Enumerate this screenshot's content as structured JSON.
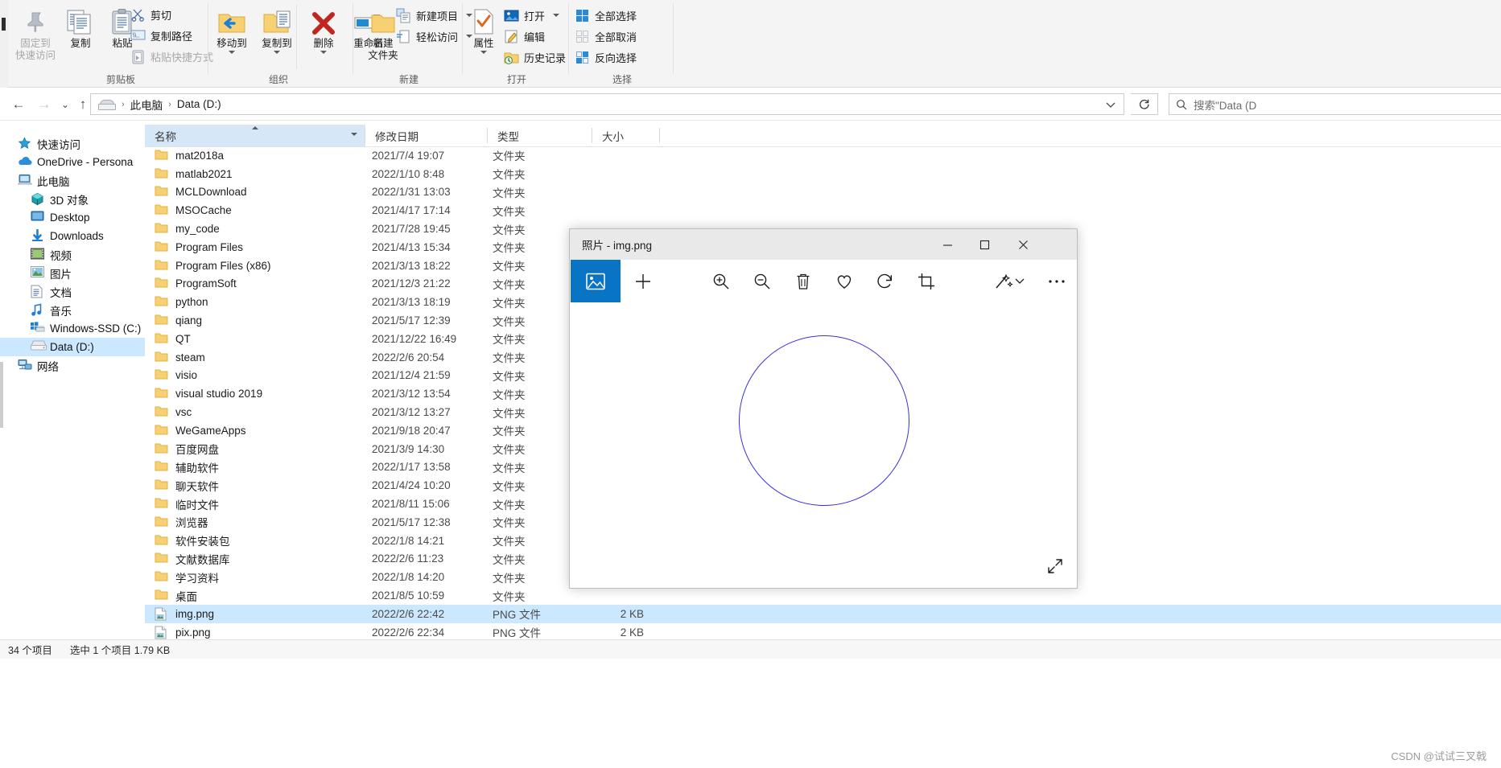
{
  "ribbon": {
    "groups": [
      {
        "id": "clipboard",
        "label": "剪贴板"
      },
      {
        "id": "organize",
        "label": "组织"
      },
      {
        "id": "new",
        "label": "新建"
      },
      {
        "id": "open",
        "label": "打开"
      },
      {
        "id": "select",
        "label": "选择"
      }
    ],
    "pin_to_quick_access": {
      "line1": "固定到",
      "line2": "快速访问"
    },
    "copy": "复制",
    "paste": "粘贴",
    "cut": "剪切",
    "copy_path": "复制路径",
    "paste_shortcut": "粘贴快捷方式",
    "move_to": "移动到",
    "copy_to": "复制到",
    "delete": "删除",
    "rename": "重命名",
    "new_folder": {
      "line1": "新建",
      "line2": "文件夹"
    },
    "new_item": "新建项目",
    "easy_access": "轻松访问",
    "properties": "属性",
    "open": "打开",
    "edit": "编辑",
    "history": "历史记录",
    "select_all": "全部选择",
    "select_none": "全部取消",
    "invert_selection": "反向选择"
  },
  "address": {
    "breadcrumbs": [
      "此电脑",
      "Data (D:)"
    ],
    "separator": "›",
    "back_icon": "←",
    "forward_icon": "→",
    "recent_icon": "⌄",
    "up_icon": "↑",
    "refresh_icon": "↻",
    "drive_icon": "drive-icon"
  },
  "search": {
    "placeholder": "搜索\"Data (D",
    "icon": "search-icon"
  },
  "sidebar": {
    "items": [
      {
        "label": "快速访问",
        "icon": "star-pin-icon",
        "level": 1,
        "selected": false
      },
      {
        "label": "OneDrive - Persona",
        "icon": "onedrive-cloud-icon",
        "level": 1,
        "selected": false
      },
      {
        "label": "此电脑",
        "icon": "this-pc-icon",
        "level": 1,
        "selected": false
      },
      {
        "label": "3D 对象",
        "icon": "3d-objects-icon",
        "level": 2,
        "selected": false
      },
      {
        "label": "Desktop",
        "icon": "desktop-icon",
        "level": 2,
        "selected": false
      },
      {
        "label": "Downloads",
        "icon": "downloads-icon",
        "level": 2,
        "selected": false
      },
      {
        "label": "视频",
        "icon": "videos-icon",
        "level": 2,
        "selected": false
      },
      {
        "label": "图片",
        "icon": "pictures-icon",
        "level": 2,
        "selected": false
      },
      {
        "label": "文档",
        "icon": "documents-icon",
        "level": 2,
        "selected": false
      },
      {
        "label": "音乐",
        "icon": "music-icon",
        "level": 2,
        "selected": false
      },
      {
        "label": "Windows-SSD (C:)",
        "icon": "drive-windows-icon",
        "level": 2,
        "selected": false
      },
      {
        "label": "Data (D:)",
        "icon": "drive-icon",
        "level": 2,
        "selected": true
      },
      {
        "label": "网络",
        "icon": "network-icon",
        "level": 1,
        "selected": false
      }
    ]
  },
  "filelist": {
    "columns": [
      {
        "key": "name",
        "label": "名称",
        "sorted": true
      },
      {
        "key": "date",
        "label": "修改日期",
        "sorted": false
      },
      {
        "key": "type",
        "label": "类型",
        "sorted": false
      },
      {
        "key": "size",
        "label": "大小",
        "sorted": false
      }
    ],
    "rows": [
      {
        "name": "mat2018a",
        "date": "2021/7/4 19:07",
        "type": "文件夹",
        "size": "",
        "icon": "folder-icon",
        "selected": false
      },
      {
        "name": "matlab2021",
        "date": "2022/1/10 8:48",
        "type": "文件夹",
        "size": "",
        "icon": "folder-icon",
        "selected": false
      },
      {
        "name": "MCLDownload",
        "date": "2022/1/31 13:03",
        "type": "文件夹",
        "size": "",
        "icon": "folder-icon",
        "selected": false
      },
      {
        "name": "MSOCache",
        "date": "2021/4/17 17:14",
        "type": "文件夹",
        "size": "",
        "icon": "folder-icon",
        "selected": false
      },
      {
        "name": "my_code",
        "date": "2021/7/28 19:45",
        "type": "文件夹",
        "size": "",
        "icon": "folder-icon",
        "selected": false
      },
      {
        "name": "Program Files",
        "date": "2021/4/13 15:34",
        "type": "文件夹",
        "size": "",
        "icon": "folder-icon",
        "selected": false
      },
      {
        "name": "Program Files (x86)",
        "date": "2021/3/13 18:22",
        "type": "文件夹",
        "size": "",
        "icon": "folder-icon",
        "selected": false
      },
      {
        "name": "ProgramSoft",
        "date": "2021/12/3 21:22",
        "type": "文件夹",
        "size": "",
        "icon": "folder-icon",
        "selected": false
      },
      {
        "name": "python",
        "date": "2021/3/13 18:19",
        "type": "文件夹",
        "size": "",
        "icon": "folder-icon",
        "selected": false
      },
      {
        "name": "qiang",
        "date": "2021/5/17 12:39",
        "type": "文件夹",
        "size": "",
        "icon": "folder-icon",
        "selected": false
      },
      {
        "name": "QT",
        "date": "2021/12/22 16:49",
        "type": "文件夹",
        "size": "",
        "icon": "folder-icon",
        "selected": false
      },
      {
        "name": "steam",
        "date": "2022/2/6 20:54",
        "type": "文件夹",
        "size": "",
        "icon": "folder-icon",
        "selected": false
      },
      {
        "name": "visio",
        "date": "2021/12/4 21:59",
        "type": "文件夹",
        "size": "",
        "icon": "folder-icon",
        "selected": false
      },
      {
        "name": "visual studio 2019",
        "date": "2021/3/12 13:54",
        "type": "文件夹",
        "size": "",
        "icon": "folder-icon",
        "selected": false
      },
      {
        "name": "vsc",
        "date": "2021/3/12 13:27",
        "type": "文件夹",
        "size": "",
        "icon": "folder-icon",
        "selected": false
      },
      {
        "name": "WeGameApps",
        "date": "2021/9/18 20:47",
        "type": "文件夹",
        "size": "",
        "icon": "folder-icon",
        "selected": false
      },
      {
        "name": "百度网盘",
        "date": "2021/3/9 14:30",
        "type": "文件夹",
        "size": "",
        "icon": "folder-icon",
        "selected": false
      },
      {
        "name": "辅助软件",
        "date": "2022/1/17 13:58",
        "type": "文件夹",
        "size": "",
        "icon": "folder-icon",
        "selected": false
      },
      {
        "name": "聊天软件",
        "date": "2021/4/24 10:20",
        "type": "文件夹",
        "size": "",
        "icon": "folder-icon",
        "selected": false
      },
      {
        "name": "临时文件",
        "date": "2021/8/11 15:06",
        "type": "文件夹",
        "size": "",
        "icon": "folder-icon",
        "selected": false
      },
      {
        "name": "浏览器",
        "date": "2021/5/17 12:38",
        "type": "文件夹",
        "size": "",
        "icon": "folder-icon",
        "selected": false
      },
      {
        "name": "软件安装包",
        "date": "2022/1/8 14:21",
        "type": "文件夹",
        "size": "",
        "icon": "folder-icon",
        "selected": false
      },
      {
        "name": "文献数据库",
        "date": "2022/2/6 11:23",
        "type": "文件夹",
        "size": "",
        "icon": "folder-icon",
        "selected": false
      },
      {
        "name": "学习资料",
        "date": "2022/1/8 14:20",
        "type": "文件夹",
        "size": "",
        "icon": "folder-icon",
        "selected": false
      },
      {
        "name": "桌面",
        "date": "2021/8/5 10:59",
        "type": "文件夹",
        "size": "",
        "icon": "folder-icon",
        "selected": false
      },
      {
        "name": "img.png",
        "date": "2022/2/6 22:42",
        "type": "PNG 文件",
        "size": "2 KB",
        "icon": "png-file-icon",
        "selected": true
      },
      {
        "name": "pix.png",
        "date": "2022/2/6 22:34",
        "type": "PNG 文件",
        "size": "2 KB",
        "icon": "png-file-icon",
        "selected": false
      }
    ]
  },
  "statusbar": {
    "item_count": "34 个项目",
    "selection": "选中 1 个项目 1.79 KB"
  },
  "photos_window": {
    "title": "照片 - img.png",
    "controls": {
      "minimize": "—",
      "maximize": "☐",
      "close": "✕"
    },
    "toolbar": [
      {
        "name": "view-image-button",
        "icon": "image-icon",
        "active": true
      },
      {
        "name": "add-button",
        "icon": "plus-icon",
        "active": false
      },
      {
        "name": "zoom-in-button",
        "icon": "zoom-in-icon",
        "active": false
      },
      {
        "name": "zoom-out-button",
        "icon": "zoom-out-icon",
        "active": false
      },
      {
        "name": "delete-button",
        "icon": "trash-icon",
        "active": false
      },
      {
        "name": "favorite-button",
        "icon": "heart-icon",
        "active": false
      },
      {
        "name": "rotate-button",
        "icon": "rotate-icon",
        "active": false
      },
      {
        "name": "crop-button",
        "icon": "crop-icon",
        "active": false
      },
      {
        "name": "edit-button",
        "icon": "magic-wand-icon",
        "active": false
      },
      {
        "name": "edit-dropdown",
        "icon": "chevron-down-icon",
        "active": false
      },
      {
        "name": "more-button",
        "icon": "ellipsis-icon",
        "active": false
      }
    ],
    "image": {
      "shape": "circle",
      "stroke": "#3a30d8"
    },
    "expand_icon": "expand-arrows-icon"
  },
  "watermark": "CSDN @试试三叉戟",
  "colors": {
    "accent": "#0a74c4",
    "selection": "#cce8ff",
    "folder": "#f7d073",
    "circle_stroke": "#3a30d8"
  }
}
